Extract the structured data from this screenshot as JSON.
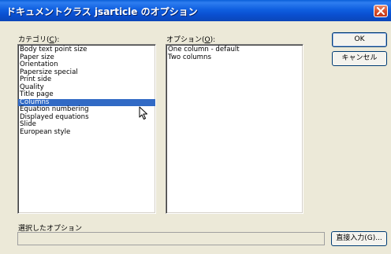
{
  "window": {
    "title": "ドキュメントクラス jsarticle のオプション"
  },
  "category": {
    "label_pre": "カテゴリ(",
    "label_key": "C",
    "label_post": "):",
    "items": [
      "Body text point size",
      "Paper size",
      "Orientation",
      "Papersize special",
      "Print side",
      "Quality",
      "Title page",
      "Columns",
      "Equation numbering",
      "Displayed equations",
      "Slide",
      "European style"
    ],
    "selected_index": 7
  },
  "options": {
    "label_pre": "オプション(",
    "label_key": "O",
    "label_post": "):",
    "items": [
      "One column - default",
      "Two columns"
    ]
  },
  "buttons": {
    "ok": "OK",
    "cancel": "キャンセル",
    "direct_input": "直接入力(G)..."
  },
  "selected_options": {
    "label": "選択したオプション",
    "value": ""
  },
  "colors": {
    "titlebar": "#0a5fd8",
    "selection": "#316ac5",
    "dialog_bg": "#ece9d8",
    "close": "#d9512b"
  }
}
